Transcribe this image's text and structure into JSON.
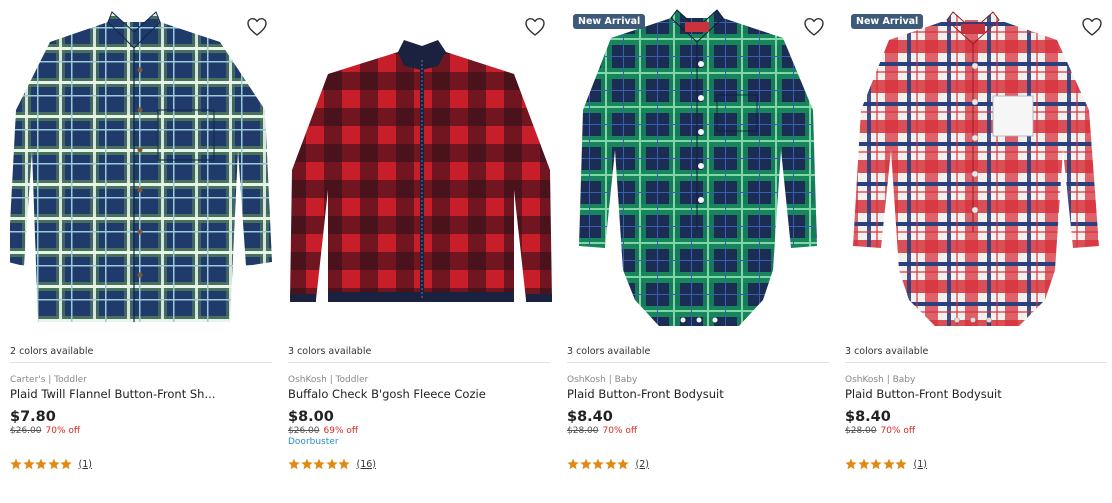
{
  "colors": {
    "badge_bg": "#3d5a7a",
    "discount": "#e2241c",
    "promo": "#2c8fc6",
    "star": "#e08a13"
  },
  "icons": {
    "wishlist": "heart-outline-icon",
    "star": "star-icon"
  },
  "products": [
    {
      "badge": "",
      "colors_available": "2 colors available",
      "brand": "Carter's | Toddler",
      "name": "Plaid Twill Flannel Button-Front Sh...",
      "price": "$7.80",
      "original_price": "$26.00",
      "discount": "70% off",
      "promo": "",
      "rating": 5,
      "reviews": "(1)"
    },
    {
      "badge": "",
      "colors_available": "3 colors available",
      "brand": "OshKosh | Toddler",
      "name": "Buffalo Check B'gosh Fleece Cozie",
      "price": "$8.00",
      "original_price": "$26.00",
      "discount": "69% off",
      "promo": "Doorbuster",
      "rating": 4.8,
      "reviews": "(16)"
    },
    {
      "badge": "New Arrival",
      "colors_available": "3 colors available",
      "brand": "OshKosh | Baby",
      "name": "Plaid Button-Front Bodysuit",
      "price": "$8.40",
      "original_price": "$28.00",
      "discount": "70% off",
      "promo": "",
      "rating": 5,
      "reviews": "(2)"
    },
    {
      "badge": "New Arrival",
      "colors_available": "3 colors available",
      "brand": "OshKosh | Baby",
      "name": "Plaid Button-Front Bodysuit",
      "price": "$8.40",
      "original_price": "$28.00",
      "discount": "70% off",
      "promo": "",
      "rating": 5,
      "reviews": "(1)"
    }
  ]
}
